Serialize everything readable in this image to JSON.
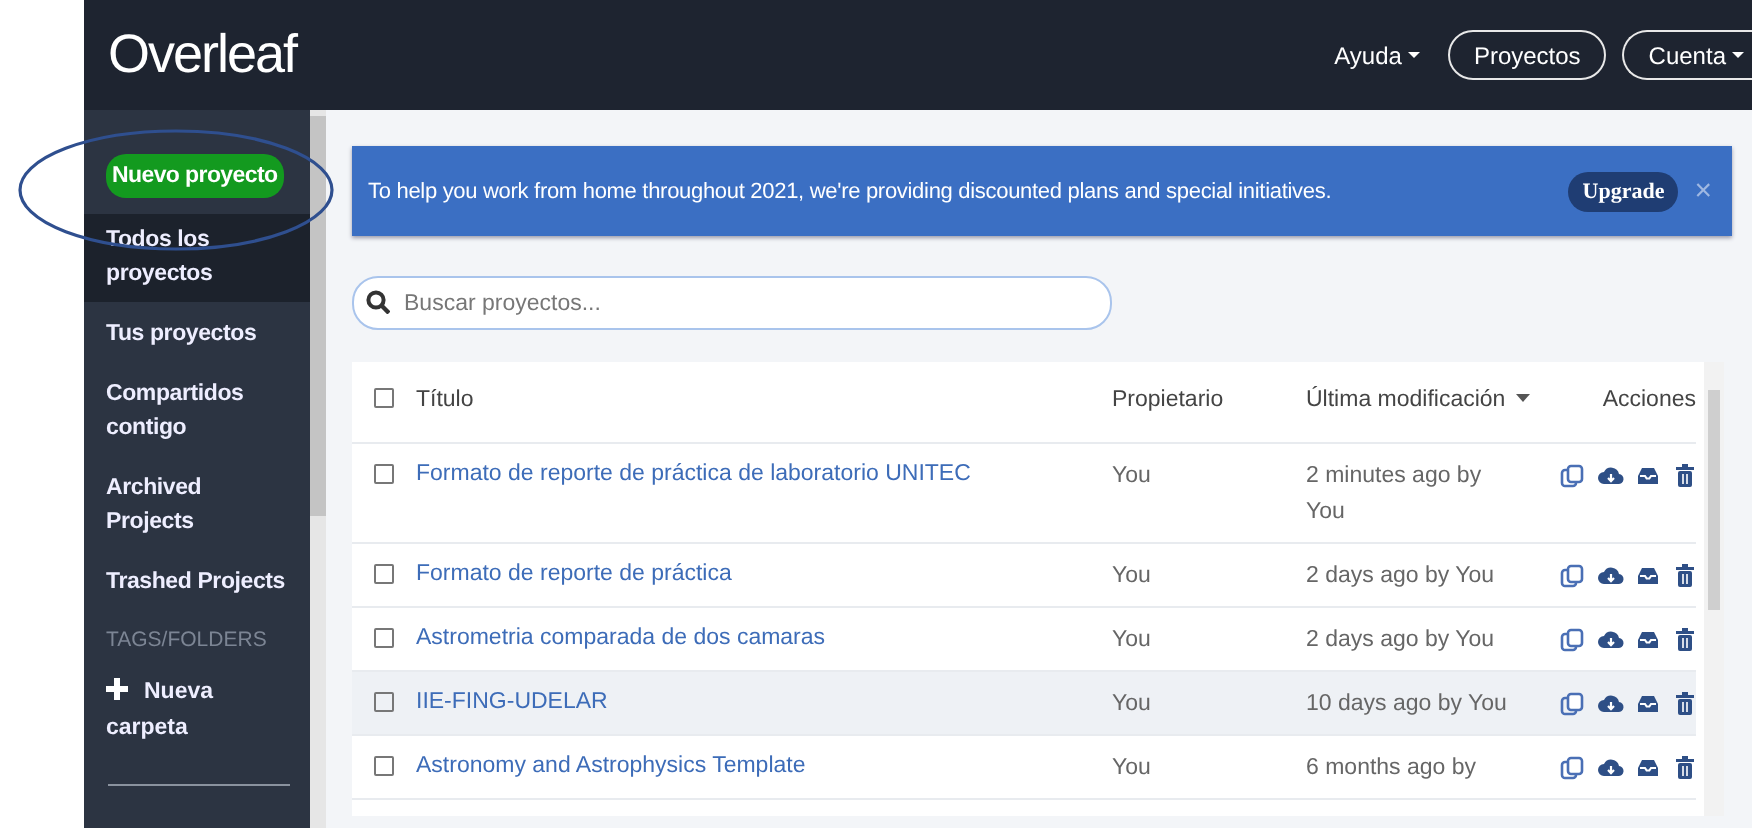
{
  "header": {
    "logo": "Overleaf",
    "nav": [
      {
        "label": "Ayuda",
        "outlined": false,
        "dropdown": true
      },
      {
        "label": "Proyectos",
        "outlined": true,
        "dropdown": false
      },
      {
        "label": "Cuenta",
        "outlined": true,
        "dropdown": true
      }
    ]
  },
  "sidebar": {
    "new_project_button": "Nuevo proyecto",
    "items": [
      {
        "label": "Todos los proyectos",
        "selected": true
      },
      {
        "label": "Tus proyectos",
        "selected": false
      },
      {
        "label": "Compartidos contigo",
        "selected": false
      },
      {
        "label": "Archived Projects",
        "selected": false
      },
      {
        "label": "Trashed Projects",
        "selected": false
      }
    ],
    "section_label": "TAGS/FOLDERS",
    "new_folder": "Nueva carpeta"
  },
  "banner": {
    "text": "To help you work from home throughout 2021, we're providing discounted plans and special initiatives.",
    "upgrade_button": "Upgrade",
    "close": "×"
  },
  "search": {
    "placeholder": "Buscar proyectos..."
  },
  "table": {
    "select_all_checked": false,
    "columns": [
      {
        "label": "Título",
        "sorted": false
      },
      {
        "label": "Propietario",
        "sorted": false
      },
      {
        "label": "Última modificación",
        "sorted": true
      },
      {
        "label": "Acciones",
        "sorted": false
      }
    ],
    "rows": [
      {
        "title": "Formato de reporte de práctica de laboratorio UNITEC",
        "owner": "You",
        "modified": "2 minutes ago by You",
        "checked": false,
        "highlighted": false
      },
      {
        "title": "Formato de reporte de práctica",
        "owner": "You",
        "modified": "2 days ago by You",
        "checked": false,
        "highlighted": false
      },
      {
        "title": "Astrometria comparada de dos camaras",
        "owner": "You",
        "modified": "2 days ago by You",
        "checked": false,
        "highlighted": false
      },
      {
        "title": "IIE-FING-UDELAR",
        "owner": "You",
        "modified": "10 days ago by You",
        "checked": false,
        "highlighted": true
      },
      {
        "title": "Astronomy and Astrophysics Template",
        "owner": "You",
        "modified": "6 months ago by",
        "checked": false,
        "highlighted": false
      }
    ]
  }
}
